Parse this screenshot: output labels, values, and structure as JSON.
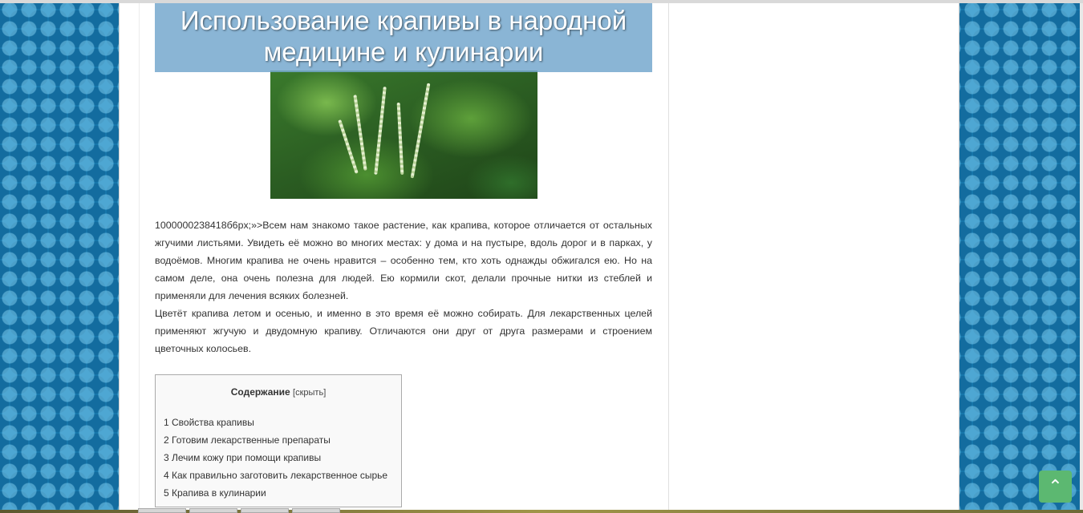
{
  "article": {
    "title_line1": "Использование крапивы в народной",
    "title_line2": "медицине и кулинарии",
    "image_icon": "nettle-photo",
    "paragraph1": "1000000238418б6px;»>Всем нам знакомо такое растение, как крапива, которое отличается от остальных жгучими листьями. Увидеть её можно во многих местах: у дома и на пустыре, вдоль дорог и в парках, у водоёмов. Многим крапива не очень нравится – особенно тем, кто хоть однажды обжигался ею. Но на самом деле, она очень полезна для людей. Ею кормили скот, делали прочные нитки из стеблей и применяли для лечения всяких болезней.",
    "paragraph2": "Цветёт крапива летом и осенью, и именно в это время её можно собирать. Для лекарственных целей применяют жгучую и двудомную крапиву. Отличаются они друг от друга  размерами и строением цветочных колосьев."
  },
  "toc": {
    "title": "Содержание",
    "toggle": "[скрыть]",
    "items": [
      "1 Свойства крапивы",
      "2 Готовим лекарственные препараты",
      "3 Лечим кожу при помощи крапивы",
      "4 Как правильно заготовить лекарственное сырье",
      "5 Крапива в кулинарии"
    ]
  },
  "scroll_top": {
    "icon": "chevron-up-icon",
    "glyph": "⌃"
  },
  "colors": {
    "background": "#1a7fb5",
    "title_banner": "#76a8ce",
    "scroll_button": "#5cb871"
  }
}
